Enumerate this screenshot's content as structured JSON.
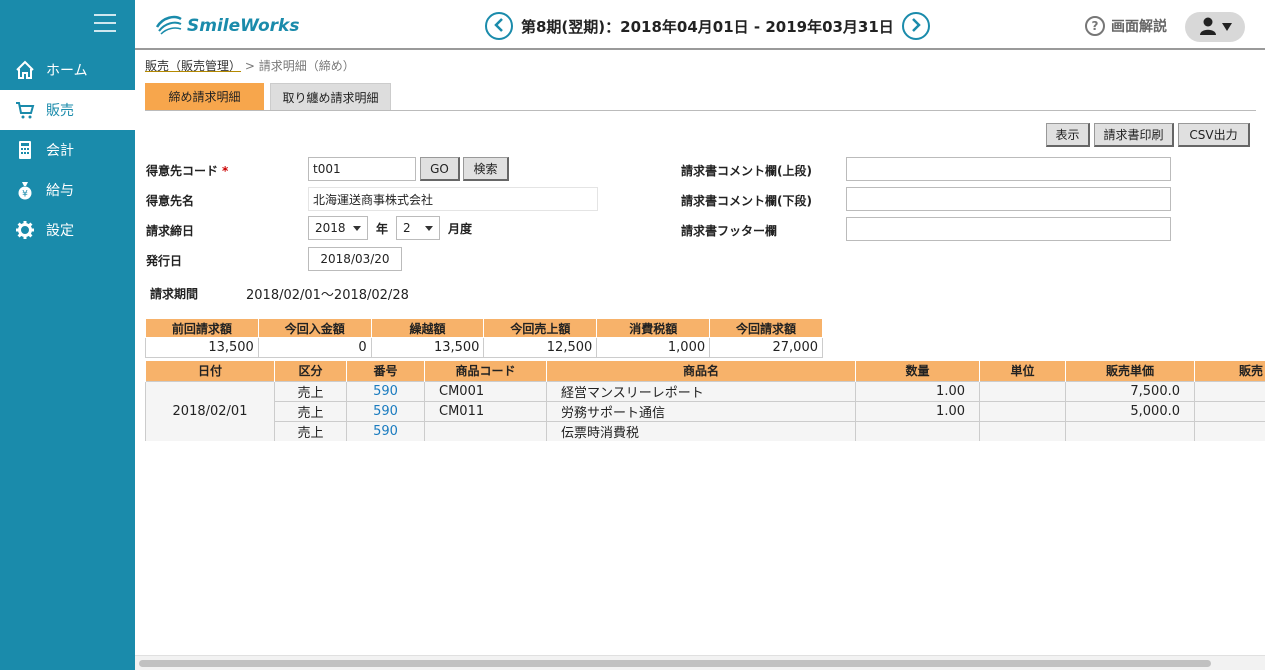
{
  "app": {
    "logo_text": "SmileWorks"
  },
  "colors": {
    "sidebar": "#1a8bab",
    "tab_active": "#f7a64c",
    "table_header": "#f7b26a",
    "link": "#1a7bbf"
  },
  "sidebar": {
    "items": [
      {
        "label": "ホーム",
        "icon": "home-icon"
      },
      {
        "label": "販売",
        "icon": "cart-icon"
      },
      {
        "label": "会計",
        "icon": "calculator-icon"
      },
      {
        "label": "給与",
        "icon": "money-bag-icon"
      },
      {
        "label": "設定",
        "icon": "gear-icon"
      }
    ]
  },
  "header": {
    "period": "第8期(翌期)：2018年04月01日 - 2019年03月31日",
    "help_label": "画面解説"
  },
  "breadcrumb": {
    "parent": "販売（販売管理）",
    "separator": ">",
    "current": "請求明細（締め）"
  },
  "tabs": [
    {
      "label": "締め請求明細"
    },
    {
      "label": "取り纏め請求明細"
    }
  ],
  "toolbar": {
    "show": "表示",
    "print": "請求書印刷",
    "csv": "CSV出力"
  },
  "form": {
    "customer_code_label": "得意先コード",
    "required_mark": "*",
    "customer_code_value": "t001",
    "go": "GO",
    "search": "検索",
    "customer_name_label": "得意先名",
    "customer_name_value": "北海運送商事株式会社",
    "closing_date_label": "請求締日",
    "year_value": "2018",
    "year_unit": "年",
    "month_value": "2",
    "month_unit": "月度",
    "issue_date_label": "発行日",
    "issue_date_value": "2018/03/20",
    "period_label": "請求期間",
    "period_value": "2018/02/01～2018/02/28",
    "comment_upper_label": "請求書コメント欄(上段)",
    "comment_lower_label": "請求書コメント欄(下段)",
    "footer_label": "請求書フッター欄"
  },
  "summary": {
    "headers": [
      "前回請求額",
      "今回入金額",
      "繰越額",
      "今回売上額",
      "消費税額",
      "今回請求額"
    ],
    "values": [
      "13,500",
      "0",
      "13,500",
      "12,500",
      "1,000",
      "27,000"
    ]
  },
  "details": {
    "headers": [
      "日付",
      "区分",
      "番号",
      "商品コード",
      "商品名",
      "数量",
      "単位",
      "販売単価",
      "販売"
    ],
    "date": "2018/02/01",
    "rows": [
      {
        "type": "売上",
        "number": "590",
        "code": "CM001",
        "name": "経営マンスリーレポート",
        "qty": "1.00",
        "unit": "",
        "price": "7,500.0"
      },
      {
        "type": "売上",
        "number": "590",
        "code": "CM011",
        "name": "労務サポート通信",
        "qty": "1.00",
        "unit": "",
        "price": "5,000.0"
      },
      {
        "type": "売上",
        "number": "590",
        "code": "",
        "name": "伝票時消費税",
        "qty": "",
        "unit": "",
        "price": ""
      }
    ]
  }
}
